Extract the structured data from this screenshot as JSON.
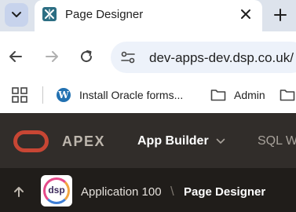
{
  "browser": {
    "tab": {
      "title": "Page Designer",
      "favicon": "apex-page-designer-icon"
    },
    "address_bar": {
      "url": "dev-apps-dev.dsp.co.uk/"
    },
    "bookmarks": [
      {
        "label": "Install Oracle forms...",
        "icon": "wordpress-icon"
      },
      {
        "label": "Admin",
        "icon": "folder-icon"
      },
      {
        "label": "",
        "icon": "folder-icon"
      }
    ]
  },
  "apex": {
    "brand": "APEX",
    "nav": {
      "app_builder": "App Builder",
      "sql_workshop": "SQL W"
    },
    "breadcrumb": {
      "application": "Application 100",
      "separator": "\\",
      "page": "Page Designer"
    },
    "app_icon_text": "dsp"
  },
  "colors": {
    "tabstrip": "#dde3ec",
    "apex_header": "#312d2a",
    "apex_subbar": "#201d1a",
    "oracle_red": "#c74634"
  }
}
